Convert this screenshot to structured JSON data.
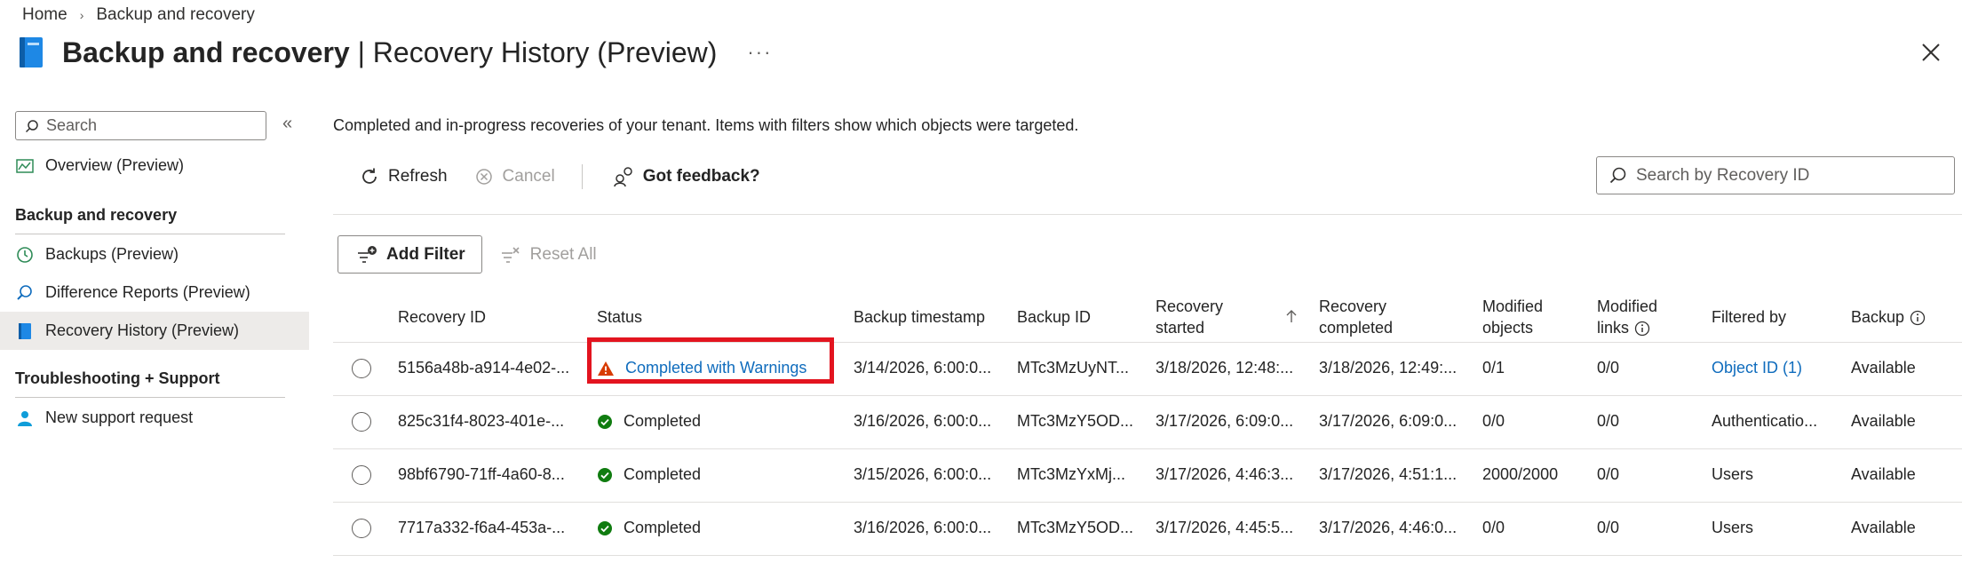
{
  "breadcrumb": {
    "home": "Home",
    "current": "Backup and recovery"
  },
  "header": {
    "title_bold": "Backup and recovery",
    "title_rest": " | Recovery History (Preview)",
    "more": "···"
  },
  "sidebar": {
    "search_placeholder": "Search",
    "collapse": "«",
    "overview": "Overview (Preview)",
    "section_backup": "Backup and recovery",
    "items": [
      "Backups (Preview)",
      "Difference Reports (Preview)",
      "Recovery History (Preview)"
    ],
    "section_support": "Troubleshooting + Support",
    "support_item": "New support request"
  },
  "main": {
    "description": "Completed and in-progress recoveries of your tenant. Items with filters show which objects were targeted.",
    "toolbar": {
      "refresh": "Refresh",
      "cancel": "Cancel",
      "feedback": "Got feedback?"
    },
    "search_placeholder": "Search by Recovery ID",
    "add_filter": "Add Filter",
    "reset_all": "Reset All"
  },
  "table": {
    "columns": {
      "recovery_id": "Recovery ID",
      "status": "Status",
      "backup_timestamp": "Backup timestamp",
      "backup_id": "Backup ID",
      "recovery_started_1": "Recovery",
      "recovery_started_2": "started",
      "recovery_completed_1": "Recovery",
      "recovery_completed_2": "completed",
      "modified_objects_1": "Modified",
      "modified_objects_2": "objects",
      "modified_links_1": "Modified",
      "modified_links_2": "links",
      "filtered_by": "Filtered by",
      "backup": "Backup"
    },
    "rows": [
      {
        "recovery_id": "5156a48b-a914-4e02-...",
        "status": "Completed with Warnings",
        "backup_timestamp": "3/14/2026, 6:00:0...",
        "backup_id": "MTc3MzUyNT...",
        "recovery_started": "3/18/2026, 12:48:...",
        "recovery_completed": "3/18/2026, 12:49:...",
        "modified_objects": "0/1",
        "modified_links": "0/0",
        "filtered_by": "Object ID (1)",
        "backup": "Available"
      },
      {
        "recovery_id": "825c31f4-8023-401e-...",
        "status": "Completed",
        "backup_timestamp": "3/16/2026, 6:00:0...",
        "backup_id": "MTc3MzY5OD...",
        "recovery_started": "3/17/2026, 6:09:0...",
        "recovery_completed": "3/17/2026, 6:09:0...",
        "modified_objects": "0/0",
        "modified_links": "0/0",
        "filtered_by": "Authenticatio...",
        "backup": "Available"
      },
      {
        "recovery_id": "98bf6790-71ff-4a60-8...",
        "status": "Completed",
        "backup_timestamp": "3/15/2026, 6:00:0...",
        "backup_id": "MTc3MzYxMj...",
        "recovery_started": "3/17/2026, 4:46:3...",
        "recovery_completed": "3/17/2026, 4:51:1...",
        "modified_objects": "2000/2000",
        "modified_links": "0/0",
        "filtered_by": "Users",
        "backup": "Available"
      },
      {
        "recovery_id": "7717a332-f6a4-453a-...",
        "status": "Completed",
        "backup_timestamp": "3/16/2026, 6:00:0...",
        "backup_id": "MTc3MzY5OD...",
        "recovery_started": "3/17/2026, 4:45:5...",
        "recovery_completed": "3/17/2026, 4:46:0...",
        "modified_objects": "0/0",
        "modified_links": "0/0",
        "filtered_by": "Users",
        "backup": "Available"
      }
    ]
  },
  "colors": {
    "accent": "#0f6cbd",
    "success": "#107c10",
    "warning": "#d83b01",
    "highlight": "#e3141f"
  }
}
